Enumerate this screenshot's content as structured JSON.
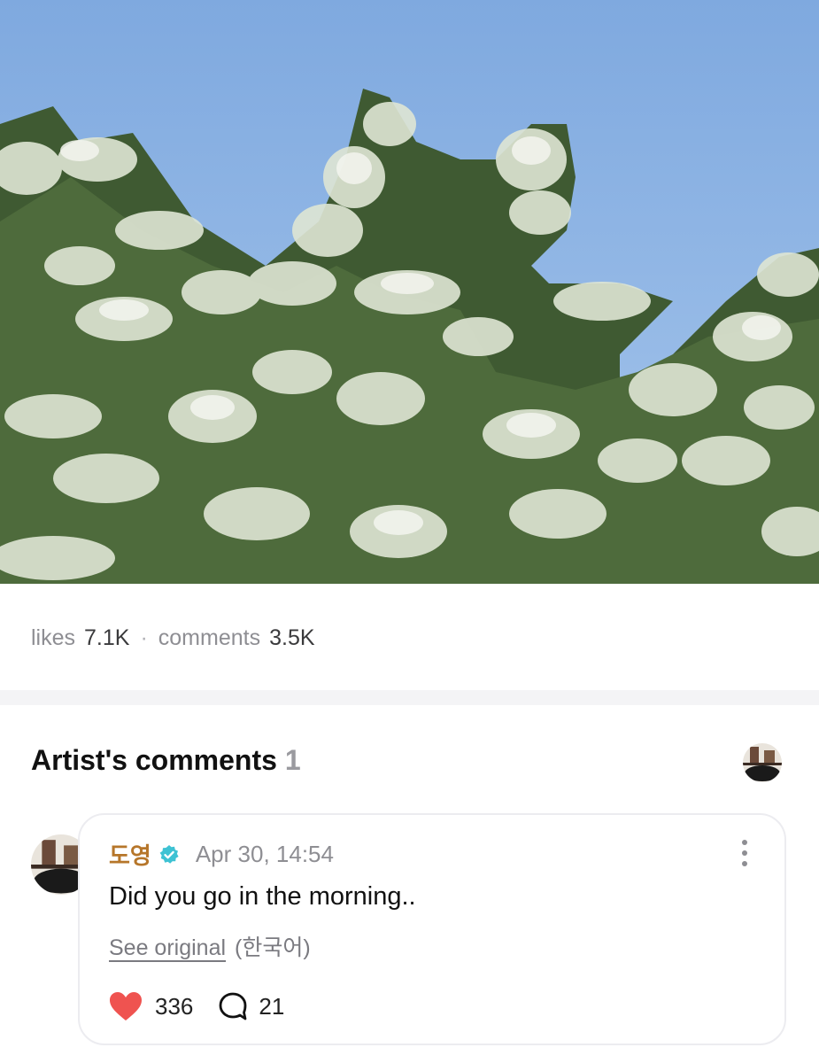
{
  "photo": {
    "icon": "tree-photo",
    "sky_color": "#8ab3e4"
  },
  "stats": {
    "likes_label": "likes",
    "likes_count": "7.1K",
    "separator": "·",
    "comments_label": "comments",
    "comments_count": "3.5K"
  },
  "section": {
    "title": "Artist's comments",
    "count": "1"
  },
  "comment": {
    "author": "도영",
    "date": "Apr 30, 14:54",
    "text": "Did you go in the morning..",
    "see_original": "See original",
    "language": "(한국어)",
    "likes": "336",
    "replies": "21",
    "accent_color": "#b6762a",
    "heart_color": "#ef5350",
    "verified_color": "#3ec2d3"
  }
}
